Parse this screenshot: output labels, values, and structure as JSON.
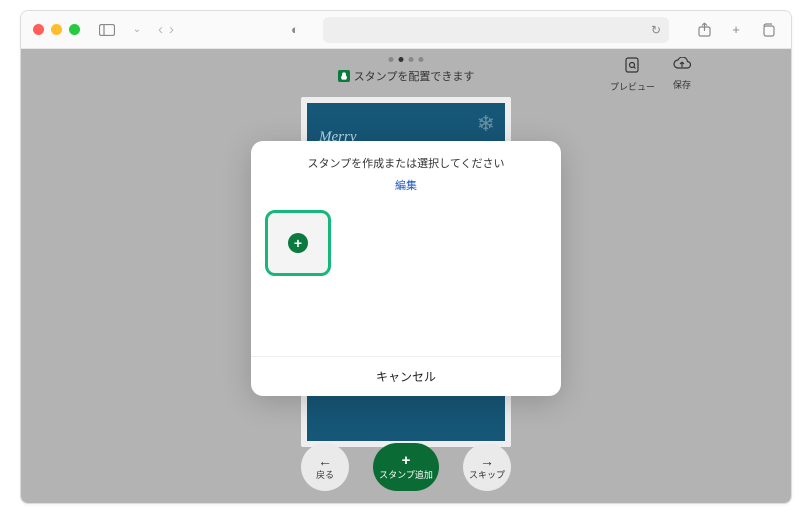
{
  "header": {
    "hint_text": "スタンプを配置できます",
    "page_indicator": {
      "count": 4,
      "active_index": 1
    }
  },
  "actions": {
    "preview_label": "プレビュー",
    "save_label": "保存"
  },
  "canvas": {
    "greeting_script": "Merry"
  },
  "controls": {
    "back_label": "戻る",
    "add_stamp_label": "スタンプ追加",
    "skip_label": "スキップ"
  },
  "modal": {
    "title": "スタンプを作成または選択してください",
    "edit_label": "編集",
    "cancel_label": "キャンセル"
  }
}
